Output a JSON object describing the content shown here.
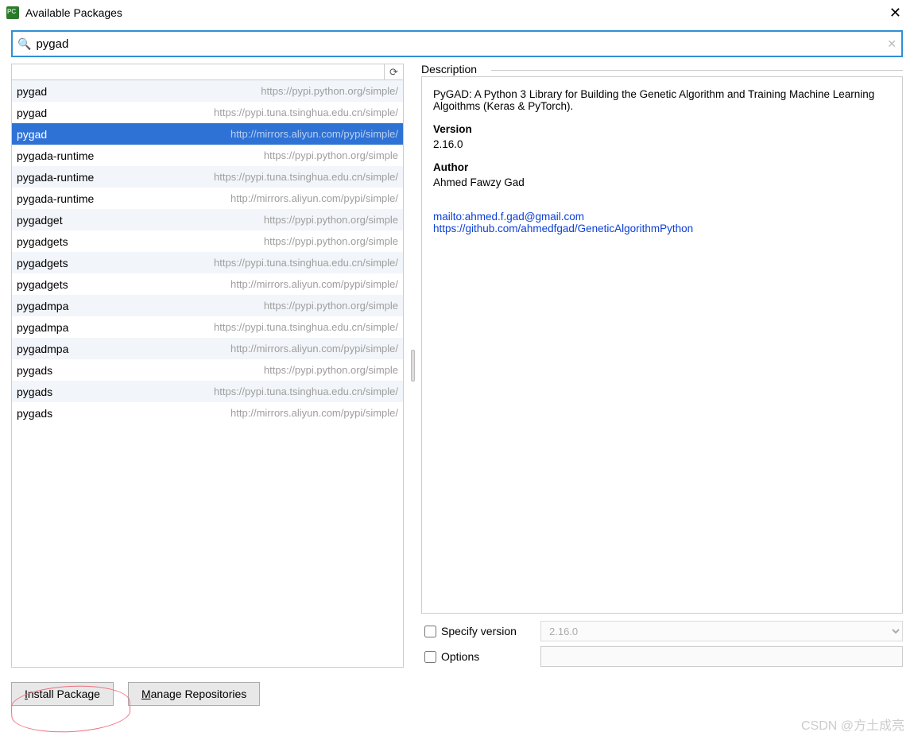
{
  "window": {
    "title": "Available Packages",
    "close_glyph": "✕"
  },
  "search": {
    "value": "pygad",
    "placeholder": ""
  },
  "packages": [
    {
      "name": "pygad",
      "source": "https://pypi.python.org/simple/",
      "selected": false
    },
    {
      "name": "pygad",
      "source": "https://pypi.tuna.tsinghua.edu.cn/simple/",
      "selected": false
    },
    {
      "name": "pygad",
      "source": "http://mirrors.aliyun.com/pypi/simple/",
      "selected": true
    },
    {
      "name": "pygada-runtime",
      "source": "https://pypi.python.org/simple",
      "selected": false
    },
    {
      "name": "pygada-runtime",
      "source": "https://pypi.tuna.tsinghua.edu.cn/simple/",
      "selected": false
    },
    {
      "name": "pygada-runtime",
      "source": "http://mirrors.aliyun.com/pypi/simple/",
      "selected": false
    },
    {
      "name": "pygadget",
      "source": "https://pypi.python.org/simple",
      "selected": false
    },
    {
      "name": "pygadgets",
      "source": "https://pypi.python.org/simple",
      "selected": false
    },
    {
      "name": "pygadgets",
      "source": "https://pypi.tuna.tsinghua.edu.cn/simple/",
      "selected": false
    },
    {
      "name": "pygadgets",
      "source": "http://mirrors.aliyun.com/pypi/simple/",
      "selected": false
    },
    {
      "name": "pygadmpa",
      "source": "https://pypi.python.org/simple",
      "selected": false
    },
    {
      "name": "pygadmpa",
      "source": "https://pypi.tuna.tsinghua.edu.cn/simple/",
      "selected": false
    },
    {
      "name": "pygadmpa",
      "source": "http://mirrors.aliyun.com/pypi/simple/",
      "selected": false
    },
    {
      "name": "pygads",
      "source": "https://pypi.python.org/simple",
      "selected": false
    },
    {
      "name": "pygads",
      "source": "https://pypi.tuna.tsinghua.edu.cn/simple/",
      "selected": false
    },
    {
      "name": "pygads",
      "source": "http://mirrors.aliyun.com/pypi/simple/",
      "selected": false
    }
  ],
  "description": {
    "heading": "Description",
    "summary": "PyGAD: A Python 3 Library for Building the Genetic Algorithm and Training Machine Learning Algoithms (Keras & PyTorch).",
    "version_label": "Version",
    "version": "2.16.0",
    "author_label": "Author",
    "author": "Ahmed Fawzy Gad",
    "email": "mailto:ahmed.f.gad@gmail.com",
    "homepage": "https://github.com/ahmedfgad/GeneticAlgorithmPython"
  },
  "options": {
    "specify_version_label": "Specify version",
    "specify_version_value": "2.16.0",
    "options_label": "Options",
    "options_value": ""
  },
  "buttons": {
    "install": "Install Package",
    "manage": "Manage Repositories"
  },
  "watermark": "CSDN @方土成亮"
}
